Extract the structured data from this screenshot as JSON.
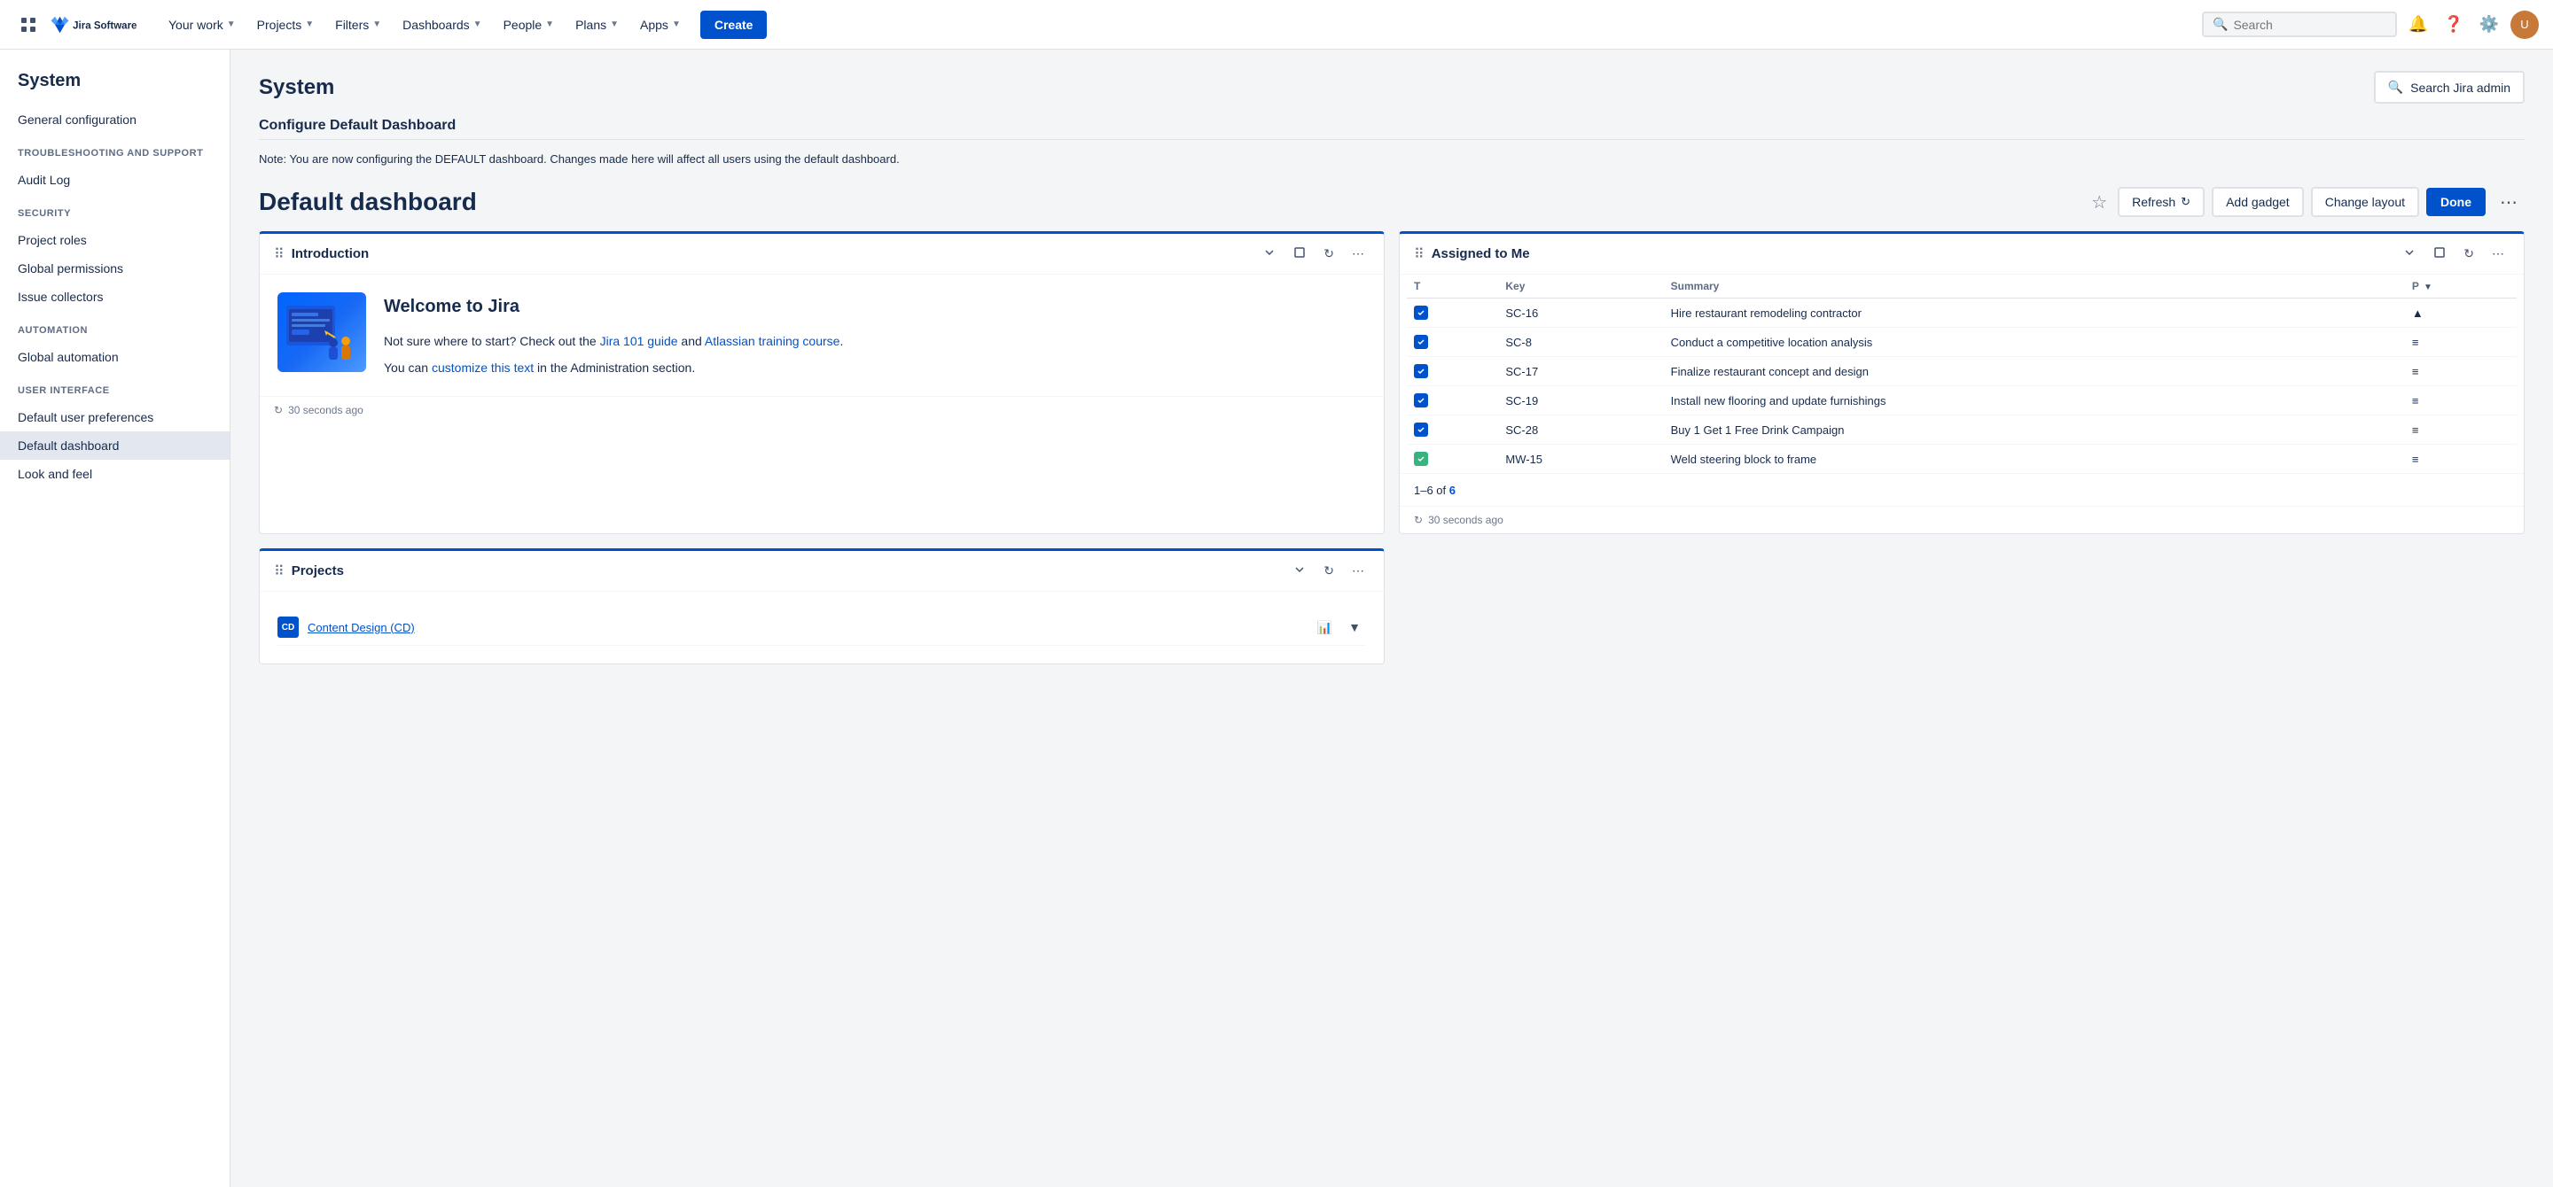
{
  "topnav": {
    "logo_text": "Jira Software",
    "nav_items": [
      {
        "label": "Your work",
        "has_chevron": true
      },
      {
        "label": "Projects",
        "has_chevron": true
      },
      {
        "label": "Filters",
        "has_chevron": true
      },
      {
        "label": "Dashboards",
        "has_chevron": true
      },
      {
        "label": "People",
        "has_chevron": true
      },
      {
        "label": "Plans",
        "has_chevron": true
      },
      {
        "label": "Apps",
        "has_chevron": true
      }
    ],
    "create_label": "Create",
    "search_placeholder": "Search"
  },
  "sidebar": {
    "title": "System",
    "items": [
      {
        "label": "General configuration",
        "section": null,
        "active": false
      },
      {
        "label": "TROUBLESHOOTING AND SUPPORT",
        "is_section": true
      },
      {
        "label": "Audit Log",
        "section": "troubleshooting",
        "active": false
      },
      {
        "label": "SECURITY",
        "is_section": true
      },
      {
        "label": "Project roles",
        "section": "security",
        "active": false
      },
      {
        "label": "Global permissions",
        "section": "security",
        "active": false
      },
      {
        "label": "Issue collectors",
        "section": "security",
        "active": false
      },
      {
        "label": "AUTOMATION",
        "is_section": true
      },
      {
        "label": "Global automation",
        "section": "automation",
        "active": false
      },
      {
        "label": "USER INTERFACE",
        "is_section": true
      },
      {
        "label": "Default user preferences",
        "section": "ui",
        "active": false
      },
      {
        "label": "Default dashboard",
        "section": "ui",
        "active": true
      },
      {
        "label": "Look and feel",
        "section": "ui",
        "active": false
      }
    ]
  },
  "page": {
    "title": "System",
    "search_admin_label": "Search Jira admin",
    "configure_title": "Configure Default Dashboard",
    "note_text": "Note: You are now configuring the DEFAULT dashboard. Changes made here will affect all users using the default dashboard.",
    "dashboard_title": "Default dashboard"
  },
  "dashboard_actions": {
    "refresh_label": "Refresh",
    "add_gadget_label": "Add gadget",
    "change_layout_label": "Change layout",
    "done_label": "Done"
  },
  "introduction_gadget": {
    "title": "Introduction",
    "welcome_text": "Welcome to Jira",
    "body_line1_pre": "Not sure where to start? Check out the ",
    "jira_guide_link": "Jira 101 guide",
    "body_line1_mid": " and ",
    "atlassian_link": "Atlassian training course",
    "body_line1_post": ".",
    "body_line2_pre": "You can ",
    "customize_link": "customize this text",
    "body_line2_post": " in the Administration section.",
    "timestamp": "30 seconds ago"
  },
  "assigned_gadget": {
    "title": "Assigned to Me",
    "columns": [
      "T",
      "Key",
      "Summary",
      "P"
    ],
    "rows": [
      {
        "type": "story",
        "key": "SC-16",
        "summary": "Hire restaurant remodeling contractor",
        "priority": "high",
        "color": "blue"
      },
      {
        "type": "story",
        "key": "SC-8",
        "summary": "Conduct a competitive location analysis",
        "priority": "medium",
        "color": "blue"
      },
      {
        "type": "story",
        "key": "SC-17",
        "summary": "Finalize restaurant concept and design",
        "priority": "medium",
        "color": "blue"
      },
      {
        "type": "story",
        "key": "SC-19",
        "summary": "Install new flooring and update furnishings",
        "priority": "medium",
        "color": "blue"
      },
      {
        "type": "story",
        "key": "SC-28",
        "summary": "Buy 1 Get 1 Free Drink Campaign",
        "priority": "medium",
        "color": "blue"
      },
      {
        "type": "task",
        "key": "MW-15",
        "summary": "Weld steering block to frame",
        "priority": "medium",
        "color": "green"
      }
    ],
    "pagination": "1–6 of 6",
    "pagination_link": "6",
    "timestamp": "30 seconds ago"
  },
  "projects_gadget": {
    "title": "Projects",
    "first_project": "Content Design (CD)"
  }
}
